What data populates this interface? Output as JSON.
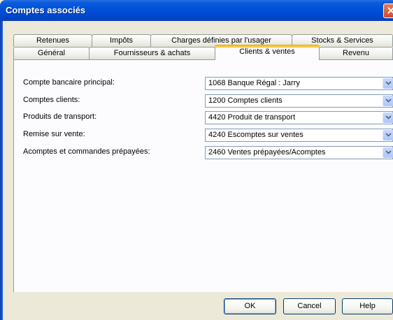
{
  "window": {
    "title": "Comptes associés"
  },
  "tabs_row1": [
    {
      "label": "Retenues"
    },
    {
      "label": "Impôts"
    },
    {
      "label": "Charges définies par l'usager"
    },
    {
      "label": "Stocks & Services"
    }
  ],
  "tabs_row2": [
    {
      "label": "Général"
    },
    {
      "label": "Fournisseurs & achats"
    },
    {
      "label": "Clients & ventes",
      "active": true
    },
    {
      "label": "Revenu"
    }
  ],
  "fields": [
    {
      "label": "Compte bancaire principal:",
      "value": "1068 Banque Régal : Jarry"
    },
    {
      "label": "Comptes clients:",
      "value": "1200 Comptes clients"
    },
    {
      "label": "Produits de transport:",
      "value": "4420 Produit de transport"
    },
    {
      "label": "Remise sur vente:",
      "value": "4240 Escomptes sur ventes"
    },
    {
      "label": "Acomptes et commandes prépayées:",
      "value": "2460 Ventes prépayées/Acomptes"
    }
  ],
  "buttons": {
    "ok": "OK",
    "cancel": "Cancel",
    "help": "Help"
  },
  "colors": {
    "titlebar": "#0050d8",
    "active_tab_accent": "#ffc83c",
    "dialog_bg": "#ece9d8"
  }
}
